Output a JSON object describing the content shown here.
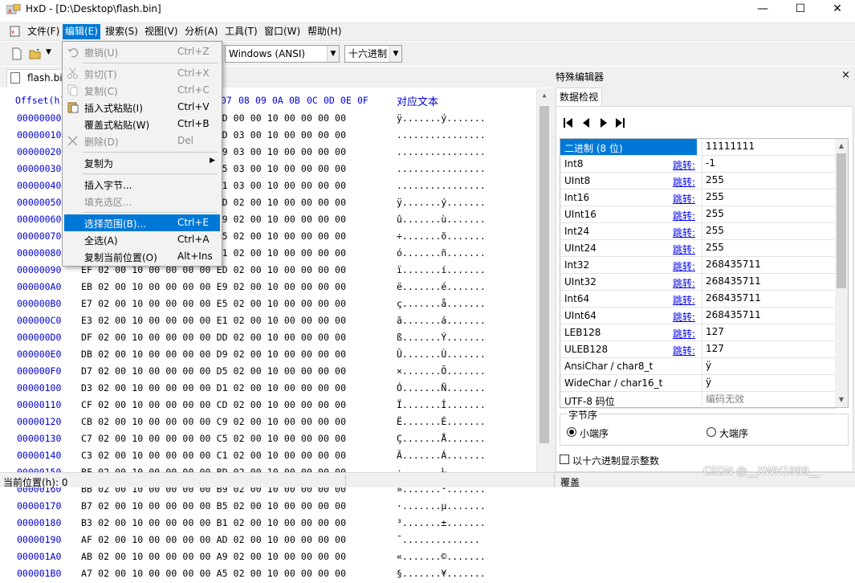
{
  "window": {
    "title": "HxD - [D:\\Desktop\\flash.bin]",
    "min_glyph": "—",
    "max_glyph": "☐",
    "close_glyph": "✕"
  },
  "menubar": {
    "items": [
      "文件(F)",
      "编辑(E)",
      "搜索(S)",
      "视图(V)",
      "分析(A)",
      "工具(T)",
      "窗口(W)",
      "帮助(H)"
    ],
    "active": "编辑(E)",
    "doc_controls": [
      "_",
      "⧉",
      "✕"
    ]
  },
  "toolbar": {
    "charset": "Windows (ANSI)",
    "numbase": "十六进制"
  },
  "edit_menu": {
    "items": [
      {
        "label": "撤销(U)",
        "shortcut": "Ctrl+Z",
        "enabled": false,
        "icon": "undo-icon"
      },
      {
        "sep": true
      },
      {
        "label": "剪切(T)",
        "shortcut": "Ctrl+X",
        "enabled": false,
        "icon": "cut-icon"
      },
      {
        "label": "复制(C)",
        "shortcut": "Ctrl+C",
        "enabled": false,
        "icon": "copy-icon"
      },
      {
        "label": "插入式粘贴(I)",
        "shortcut": "Ctrl+V",
        "enabled": true,
        "icon": "paste-icon"
      },
      {
        "label": "覆盖式粘贴(W)",
        "shortcut": "Ctrl+B",
        "enabled": true,
        "icon": ""
      },
      {
        "label": "删除(D)",
        "shortcut": "Del",
        "enabled": false,
        "icon": "delete-icon"
      },
      {
        "sep": true
      },
      {
        "label": "复制为",
        "shortcut": "",
        "enabled": true,
        "submenu": true,
        "icon": ""
      },
      {
        "sep": true
      },
      {
        "label": "插入字节...",
        "shortcut": "",
        "enabled": true,
        "icon": ""
      },
      {
        "label": "填充选区...",
        "shortcut": "",
        "enabled": false,
        "icon": ""
      },
      {
        "sep": true
      },
      {
        "label": "选择范围(B)...",
        "shortcut": "Ctrl+E",
        "enabled": true,
        "highlighted": true,
        "icon": ""
      },
      {
        "label": "全选(A)",
        "shortcut": "Ctrl+A",
        "enabled": true,
        "icon": ""
      },
      {
        "label": "复制当前位置(O)",
        "shortcut": "Alt+Ins",
        "enabled": true,
        "icon": ""
      }
    ]
  },
  "file_tab": "flash.bin",
  "hex_view": {
    "offset_header": "Offset(h)",
    "col_headers": [
      "07",
      "08",
      "09",
      "0A",
      "0B",
      "0C",
      "0D",
      "0E",
      "0F"
    ],
    "text_header": "对应文本",
    "rows": [
      {
        "off": "00000000",
        "bytes": "FF 02 00 10 00 00 00 00 FD 00 00 10 00 00 00 00",
        "ascii": "ÿ.......ý......."
      },
      {
        "off": "00000010",
        "bytes": "FE 02 00 10 00 00 00 00 0D 03 00 10 00 00 00 00",
        "ascii": "................"
      },
      {
        "off": "00000020",
        "bytes": "FD 02 00 10 00 00 00 00 09 03 00 10 00 00 00 00",
        "ascii": "................"
      },
      {
        "off": "00000030",
        "bytes": "FC 02 00 10 00 00 00 00 05 03 00 10 00 00 00 00",
        "ascii": "................"
      },
      {
        "off": "00000040",
        "bytes": "FB 02 00 10 00 00 00 00 01 03 00 10 00 00 00 00",
        "ascii": "................"
      },
      {
        "off": "00000050",
        "bytes": "FF 02 00 10 00 00 00 00 FD 02 00 10 00 00 00 00",
        "ascii": "ÿ.......ý......."
      },
      {
        "off": "00000060",
        "bytes": "FB 02 00 10 00 00 00 00 F9 02 00 10 00 00 00 00",
        "ascii": "û.......ù......."
      },
      {
        "off": "00000070",
        "bytes": "F7 02 00 10 00 00 00 00 F5 02 00 10 00 00 00 00",
        "ascii": "÷.......õ......."
      },
      {
        "off": "00000080",
        "bytes": "F3 02 00 10 00 00 00 00 F1 02 00 10 00 00 00 00",
        "ascii": "ó.......ñ......."
      },
      {
        "off": "00000090",
        "bytes": "EF 02 00 10 00 00 00 00 ED 02 00 10 00 00 00 00",
        "ascii": "ï.......í......."
      },
      {
        "off": "000000A0",
        "bytes": "EB 02 00 10 00 00 00 00 E9 02 00 10 00 00 00 00",
        "ascii": "ë.......é......."
      },
      {
        "off": "000000B0",
        "bytes": "E7 02 00 10 00 00 00 00 E5 02 00 10 00 00 00 00",
        "ascii": "ç.......å......."
      },
      {
        "off": "000000C0",
        "bytes": "E3 02 00 10 00 00 00 00 E1 02 00 10 00 00 00 00",
        "ascii": "ã.......á......."
      },
      {
        "off": "000000D0",
        "bytes": "DF 02 00 10 00 00 00 00 DD 02 00 10 00 00 00 00",
        "ascii": "ß.......Ý......."
      },
      {
        "off": "000000E0",
        "bytes": "DB 02 00 10 00 00 00 00 D9 02 00 10 00 00 00 00",
        "ascii": "Û.......Ù......."
      },
      {
        "off": "000000F0",
        "bytes": "D7 02 00 10 00 00 00 00 D5 02 00 10 00 00 00 00",
        "ascii": "×.......Õ......."
      },
      {
        "off": "00000100",
        "bytes": "D3 02 00 10 00 00 00 00 D1 02 00 10 00 00 00 00",
        "ascii": "Ó.......Ñ......."
      },
      {
        "off": "00000110",
        "bytes": "CF 02 00 10 00 00 00 00 CD 02 00 10 00 00 00 00",
        "ascii": "Ï.......Í......."
      },
      {
        "off": "00000120",
        "bytes": "CB 02 00 10 00 00 00 00 C9 02 00 10 00 00 00 00",
        "ascii": "Ë.......É......."
      },
      {
        "off": "00000130",
        "bytes": "C7 02 00 10 00 00 00 00 C5 02 00 10 00 00 00 00",
        "ascii": "Ç.......Å......."
      },
      {
        "off": "00000140",
        "bytes": "C3 02 00 10 00 00 00 00 C1 02 00 10 00 00 00 00",
        "ascii": "Ã.......Á......."
      },
      {
        "off": "00000150",
        "bytes": "BF 02 00 10 00 00 00 00 BD 02 00 10 00 00 00 00",
        "ascii": "¿.......½......."
      },
      {
        "off": "00000160",
        "bytes": "BB 02 00 10 00 00 00 00 B9 02 00 10 00 00 00 00",
        "ascii": "».......¹......."
      },
      {
        "off": "00000170",
        "bytes": "B7 02 00 10 00 00 00 00 B5 02 00 10 00 00 00 00",
        "ascii": "·.......µ......."
      },
      {
        "off": "00000180",
        "bytes": "B3 02 00 10 00 00 00 00 B1 02 00 10 00 00 00 00",
        "ascii": "³.......±......."
      },
      {
        "off": "00000190",
        "bytes": "AF 02 00 10 00 00 00 00 AD 02 00 10 00 00 00 00",
        "ascii": "¯.......­......."
      },
      {
        "off": "000001A0",
        "bytes": "AB 02 00 10 00 00 00 00 A9 02 00 10 00 00 00 00",
        "ascii": "«.......©......."
      },
      {
        "off": "000001B0",
        "bytes": "A7 02 00 10 00 00 00 00 A5 02 00 10 00 00 00 00",
        "ascii": "§.......¥......."
      }
    ]
  },
  "special_editor": {
    "title": "特殊编辑器",
    "close": "×",
    "tab": "数据检视",
    "jump_label": "跳转:",
    "rows": [
      {
        "name": "二进制 (8 位)",
        "value": "11111111",
        "jump": false,
        "selected": true
      },
      {
        "name": "Int8",
        "value": "-1",
        "jump": true
      },
      {
        "name": "UInt8",
        "value": "255",
        "jump": true
      },
      {
        "name": "Int16",
        "value": "255",
        "jump": true
      },
      {
        "name": "UInt16",
        "value": "255",
        "jump": true
      },
      {
        "name": "Int24",
        "value": "255",
        "jump": true
      },
      {
        "name": "UInt24",
        "value": "255",
        "jump": true
      },
      {
        "name": "Int32",
        "value": "268435711",
        "jump": true
      },
      {
        "name": "UInt32",
        "value": "268435711",
        "jump": true
      },
      {
        "name": "Int64",
        "value": "268435711",
        "jump": true
      },
      {
        "name": "UInt64",
        "value": "268435711",
        "jump": true
      },
      {
        "name": "LEB128",
        "value": "127",
        "jump": true
      },
      {
        "name": "ULEB128",
        "value": "127",
        "jump": true
      },
      {
        "name": "AnsiChar / char8_t",
        "value": "ÿ",
        "jump": false
      },
      {
        "name": "WideChar / char16_t",
        "value": "ÿ",
        "jump": false
      },
      {
        "name": "UTF-8 码位",
        "value": "编码无效",
        "jump": false,
        "grey": true
      }
    ],
    "byte_order_label": "字节序",
    "little_endian": "小端序",
    "big_endian": "大端序",
    "hex_int_label": "以十六进制显示整数"
  },
  "status": {
    "position": "当前位置(h): 0",
    "mode": "覆盖"
  },
  "watermark": "CSDN @__XWH1999__"
}
